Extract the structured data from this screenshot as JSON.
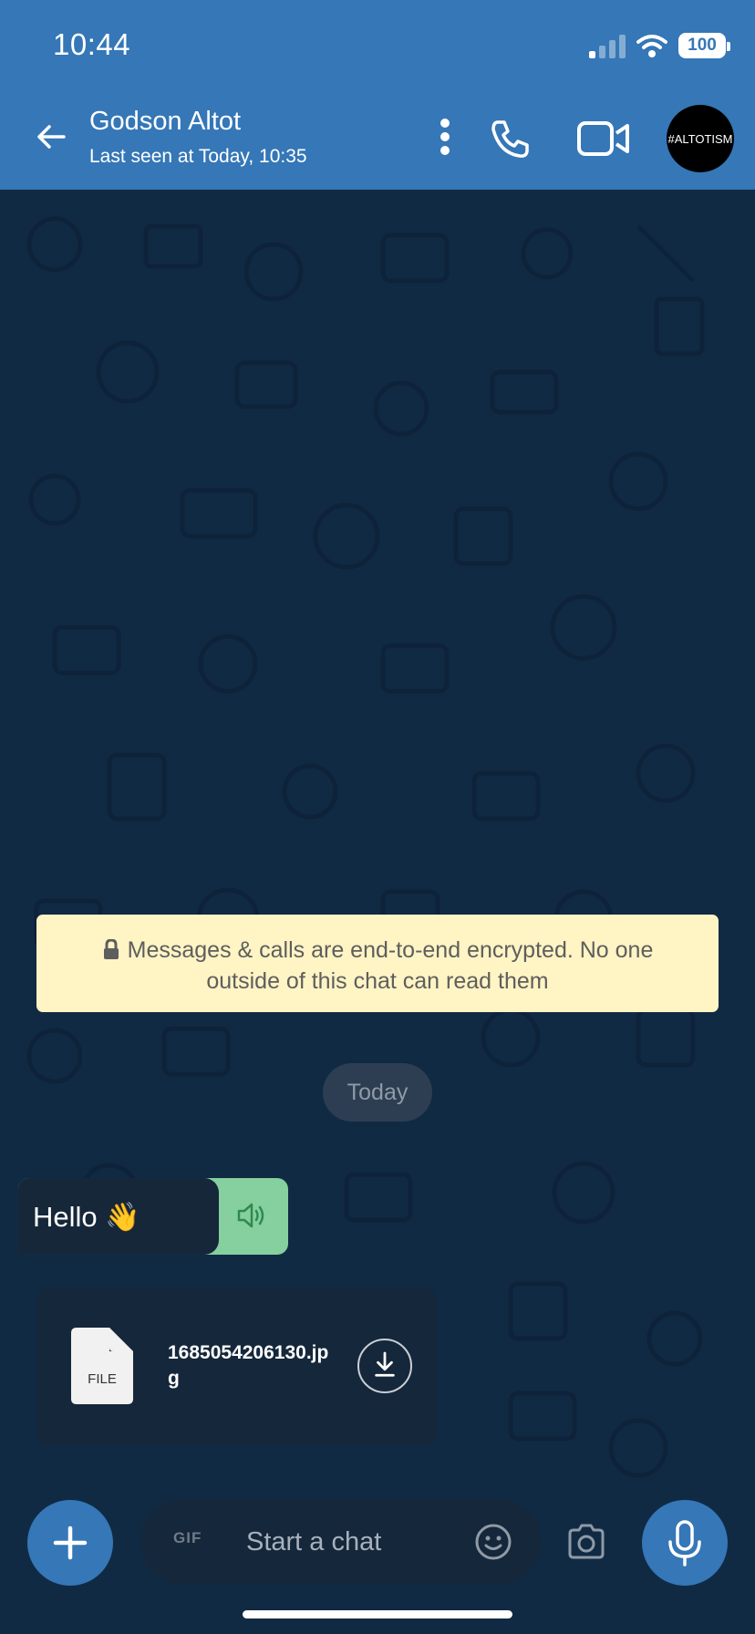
{
  "status_bar": {
    "time": "10:44",
    "battery": "100"
  },
  "header": {
    "contact_name": "Godson Altot",
    "contact_status": "Last seen at Today, 10:35",
    "avatar_text": "#ALTOTISM"
  },
  "chat": {
    "encryption_notice": "Messages & calls are end-to-end encrypted. No one outside of this chat can read them",
    "date_label": "Today",
    "messages": [
      {
        "text": "Hello 👋"
      }
    ],
    "file": {
      "icon_label": "FILE",
      "name": "1685054206130.jpg"
    }
  },
  "composer": {
    "gif_label": "GIF",
    "placeholder": "Start a chat"
  },
  "icons": {
    "back": "arrow-left-icon",
    "more": "more-vertical-icon",
    "call": "phone-icon",
    "video": "video-icon",
    "lock": "lock-icon",
    "speaker": "speaker-icon",
    "file": "file-icon",
    "download": "download-icon",
    "add": "plus-icon",
    "emoji": "emoji-icon",
    "camera": "camera-icon",
    "mic": "mic-icon"
  },
  "colors": {
    "header": "#3577b7",
    "chat_background": "#112a44",
    "notice_background": "#fff4c4",
    "speaker_accent": "#86cf9e"
  }
}
